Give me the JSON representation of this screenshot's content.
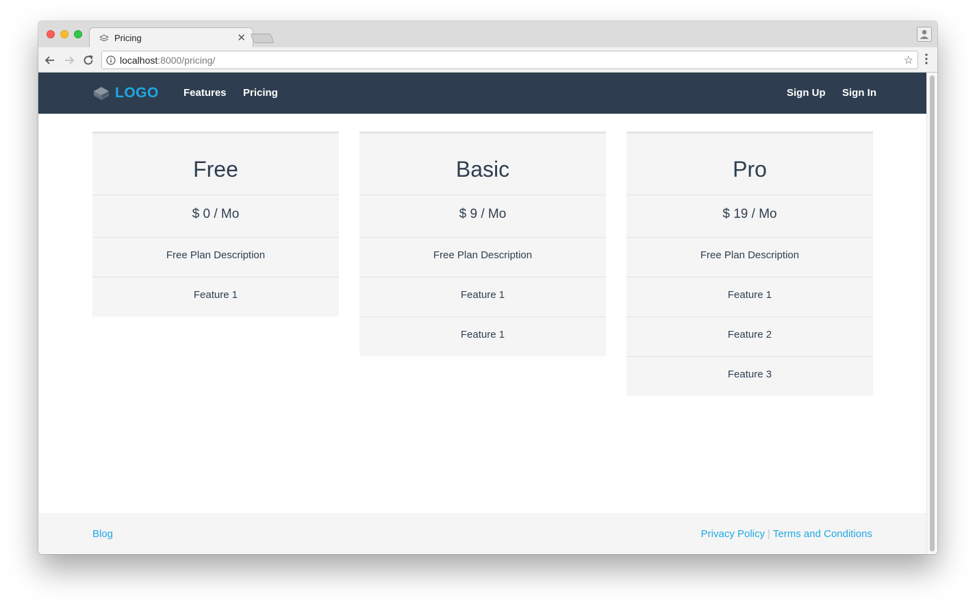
{
  "browser": {
    "tab": {
      "title": "Pricing"
    },
    "url": {
      "host": "localhost",
      "rest": ":8000/pricing/"
    }
  },
  "navbar": {
    "logo_text": "LOGO",
    "links": [
      {
        "label": "Features"
      },
      {
        "label": "Pricing"
      }
    ],
    "right_links": [
      {
        "label": "Sign Up"
      },
      {
        "label": "Sign In"
      }
    ]
  },
  "plans": [
    {
      "name": "Free",
      "price": "$ 0 / Mo",
      "description": "Free Plan Description",
      "features": [
        "Feature 1"
      ]
    },
    {
      "name": "Basic",
      "price": "$ 9 / Mo",
      "description": "Free Plan Description",
      "features": [
        "Feature 1",
        "Feature 1"
      ]
    },
    {
      "name": "Pro",
      "price": "$ 19 / Mo",
      "description": "Free Plan Description",
      "features": [
        "Feature 1",
        "Feature 2",
        "Feature 3"
      ]
    }
  ],
  "footer": {
    "blog": "Blog",
    "privacy": "Privacy Policy",
    "separator": "|",
    "terms": "Terms and Conditions"
  },
  "colors": {
    "navbar_bg": "#2e3e50",
    "accent": "#1fa8e4",
    "card_bg": "#f5f5f5"
  },
  "icons": {
    "logo": "layers-icon",
    "tab_favicon": "layers-icon",
    "back": "arrow-left-icon",
    "forward": "arrow-right-icon",
    "reload": "reload-icon",
    "info": "info-icon",
    "bookmark": "star-icon",
    "menu": "vertical-dots-icon",
    "profile": "person-icon"
  }
}
